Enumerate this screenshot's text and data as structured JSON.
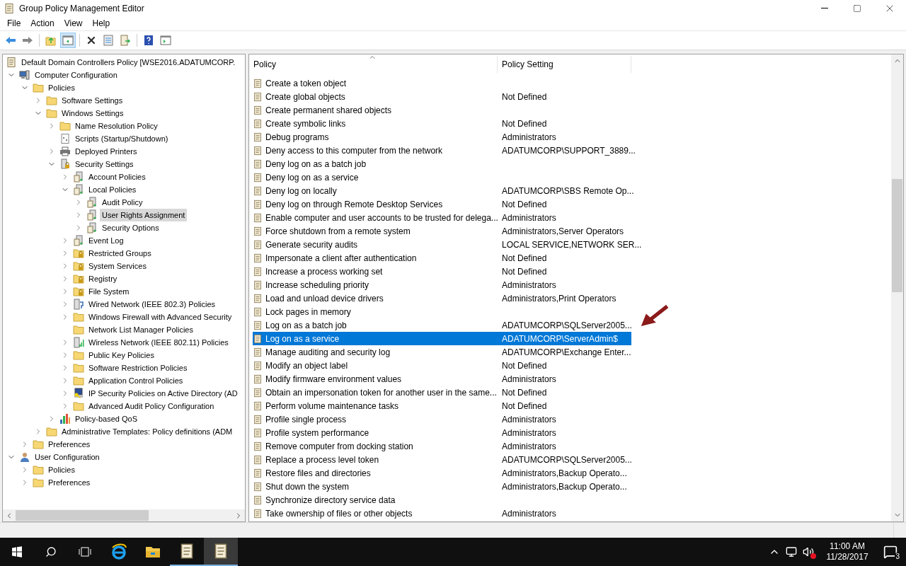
{
  "window": {
    "title": "Group Policy Management Editor"
  },
  "menu": [
    "File",
    "Action",
    "View",
    "Help"
  ],
  "tree": {
    "root": "Default Domain Controllers Policy [WSE2016.ADATUMCORP.",
    "items": [
      {
        "label": "Computer Configuration",
        "kind": "computer",
        "expanded": true,
        "selected": false,
        "children": [
          {
            "label": "Policies",
            "kind": "folder",
            "expanded": true,
            "selected": false,
            "children": [
              {
                "label": "Software Settings",
                "kind": "folder",
                "expanded": false,
                "selected": false
              },
              {
                "label": "Windows Settings",
                "kind": "folder",
                "expanded": true,
                "selected": false,
                "children": [
                  {
                    "label": "Name Resolution Policy",
                    "kind": "folder",
                    "expanded": false,
                    "selected": false
                  },
                  {
                    "label": "Scripts (Startup/Shutdown)",
                    "kind": "script",
                    "selected": false
                  },
                  {
                    "label": "Deployed Printers",
                    "kind": "printer",
                    "expanded": false,
                    "selected": false
                  },
                  {
                    "label": "Security Settings",
                    "kind": "security",
                    "expanded": true,
                    "selected": false,
                    "children": [
                      {
                        "label": "Account Policies",
                        "kind": "server",
                        "expanded": false,
                        "selected": false
                      },
                      {
                        "label": "Local Policies",
                        "kind": "server",
                        "expanded": true,
                        "selected": false,
                        "children": [
                          {
                            "label": "Audit Policy",
                            "kind": "server",
                            "expanded": false,
                            "selected": false
                          },
                          {
                            "label": "User Rights Assignment",
                            "kind": "server",
                            "expanded": false,
                            "selected": true
                          },
                          {
                            "label": "Security Options",
                            "kind": "server",
                            "expanded": false,
                            "selected": false
                          }
                        ]
                      },
                      {
                        "label": "Event Log",
                        "kind": "server",
                        "expanded": false,
                        "selected": false
                      },
                      {
                        "label": "Restricted Groups",
                        "kind": "lockfolder",
                        "expanded": false,
                        "selected": false
                      },
                      {
                        "label": "System Services",
                        "kind": "lockfolder",
                        "expanded": false,
                        "selected": false
                      },
                      {
                        "label": "Registry",
                        "kind": "lockfolder",
                        "expanded": false,
                        "selected": false
                      },
                      {
                        "label": "File System",
                        "kind": "lockfolder",
                        "expanded": false,
                        "selected": false
                      },
                      {
                        "label": "Wired Network (IEEE 802.3) Policies",
                        "kind": "wired",
                        "expanded": false,
                        "selected": false
                      },
                      {
                        "label": "Windows Firewall with Advanced Security",
                        "kind": "folder",
                        "expanded": false,
                        "selected": false
                      },
                      {
                        "label": "Network List Manager Policies",
                        "kind": "folder",
                        "selected": false
                      },
                      {
                        "label": "Wireless Network (IEEE 802.11) Policies",
                        "kind": "wireless",
                        "expanded": false,
                        "selected": false
                      },
                      {
                        "label": "Public Key Policies",
                        "kind": "folder",
                        "expanded": false,
                        "selected": false
                      },
                      {
                        "label": "Software Restriction Policies",
                        "kind": "folder",
                        "expanded": false,
                        "selected": false
                      },
                      {
                        "label": "Application Control Policies",
                        "kind": "folder",
                        "expanded": false,
                        "selected": false
                      },
                      {
                        "label": "IP Security Policies on Active Directory (AD",
                        "kind": "ipsec",
                        "expanded": false,
                        "selected": false
                      },
                      {
                        "label": "Advanced Audit Policy Configuration",
                        "kind": "folder",
                        "expanded": false,
                        "selected": false
                      }
                    ]
                  },
                  {
                    "label": "Policy-based QoS",
                    "kind": "chart",
                    "expanded": false,
                    "selected": false
                  }
                ]
              },
              {
                "label": "Administrative Templates: Policy definitions (ADM",
                "kind": "folder",
                "expanded": false,
                "selected": false
              }
            ]
          },
          {
            "label": "Preferences",
            "kind": "folder",
            "expanded": false,
            "selected": false
          }
        ]
      },
      {
        "label": "User Configuration",
        "kind": "user",
        "expanded": true,
        "selected": false,
        "children": [
          {
            "label": "Policies",
            "kind": "folder",
            "expanded": false,
            "selected": false
          },
          {
            "label": "Preferences",
            "kind": "folder",
            "expanded": false,
            "selected": false
          }
        ]
      }
    ]
  },
  "list": {
    "columns": [
      "Policy",
      "Policy Setting"
    ],
    "rows": [
      {
        "policy": "Create a token object",
        "selected": false
      },
      {
        "policy": "Create global objects",
        "setting": "Not Defined",
        "selected": false
      },
      {
        "policy": "Create permanent shared objects",
        "selected": false
      },
      {
        "policy": "Create symbolic links",
        "setting": "Not Defined",
        "selected": false
      },
      {
        "policy": "Debug programs",
        "setting": "Administrators",
        "selected": false
      },
      {
        "policy": "Deny access to this computer from the network",
        "setting": "ADATUMCORP\\SUPPORT_3889...",
        "selected": false
      },
      {
        "policy": "Deny log on as a batch job",
        "selected": false
      },
      {
        "policy": "Deny log on as a service",
        "selected": false
      },
      {
        "policy": "Deny log on locally",
        "setting": "ADATUMCORP\\SBS Remote Op...",
        "selected": false
      },
      {
        "policy": "Deny log on through Remote Desktop Services",
        "setting": "Not Defined",
        "selected": false
      },
      {
        "policy": "Enable computer and user accounts to be trusted for delega...",
        "setting": "Administrators",
        "selected": false
      },
      {
        "policy": "Force shutdown from a remote system",
        "setting": "Administrators,Server Operators",
        "selected": false
      },
      {
        "policy": "Generate security audits",
        "setting": "LOCAL SERVICE,NETWORK SER...",
        "selected": false
      },
      {
        "policy": "Impersonate a client after authentication",
        "setting": "Not Defined",
        "selected": false
      },
      {
        "policy": "Increase a process working set",
        "setting": "Not Defined",
        "selected": false
      },
      {
        "policy": "Increase scheduling priority",
        "setting": "Administrators",
        "selected": false
      },
      {
        "policy": "Load and unload device drivers",
        "setting": "Administrators,Print Operators",
        "selected": false
      },
      {
        "policy": "Lock pages in memory",
        "selected": false
      },
      {
        "policy": "Log on as a batch job",
        "setting": "ADATUMCORP\\SQLServer2005...",
        "selected": false
      },
      {
        "policy": "Log on as a service",
        "setting": "ADATUMCORP\\ServerAdmin$",
        "selected": true
      },
      {
        "policy": "Manage auditing and security log",
        "setting": "ADATUMCORP\\Exchange Enter...",
        "selected": false
      },
      {
        "policy": "Modify an object label",
        "setting": "Not Defined",
        "selected": false
      },
      {
        "policy": "Modify firmware environment values",
        "setting": "Administrators",
        "selected": false
      },
      {
        "policy": "Obtain an impersonation token for another user in the same...",
        "setting": "Not Defined",
        "selected": false
      },
      {
        "policy": "Perform volume maintenance tasks",
        "setting": "Not Defined",
        "selected": false
      },
      {
        "policy": "Profile single process",
        "setting": "Administrators",
        "selected": false
      },
      {
        "policy": "Profile system performance",
        "setting": "Administrators",
        "selected": false
      },
      {
        "policy": "Remove computer from docking station",
        "setting": "Administrators",
        "selected": false
      },
      {
        "policy": "Replace a process level token",
        "setting": "ADATUMCORP\\SQLServer2005...",
        "selected": false
      },
      {
        "policy": "Restore files and directories",
        "setting": "Administrators,Backup Operato...",
        "selected": false
      },
      {
        "policy": "Shut down the system",
        "setting": "Administrators,Backup Operato...",
        "selected": false
      },
      {
        "policy": "Synchronize directory service data",
        "selected": false
      },
      {
        "policy": "Take ownership of files or other objects",
        "setting": "Administrators",
        "selected": false
      }
    ]
  },
  "taskbar": {
    "time": "11:00 AM",
    "date": "11/28/2017",
    "notifications": "3"
  }
}
